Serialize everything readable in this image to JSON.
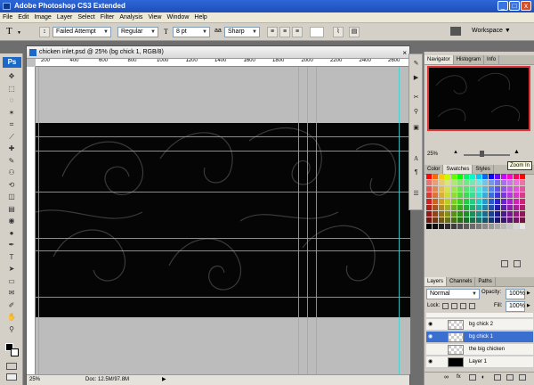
{
  "window": {
    "title": "Adobe Photoshop CS3 Extended",
    "min": "_",
    "max": "□",
    "close": "x"
  },
  "menu": [
    "File",
    "Edit",
    "Image",
    "Layer",
    "Select",
    "Filter",
    "Analysis",
    "View",
    "Window",
    "Help"
  ],
  "options": {
    "tool_glyph": "T",
    "font_family": "Failed Attempt",
    "font_style": "Regular",
    "font_size": "8 pt",
    "antialias": "Sharp",
    "workspace": "Workspace ▼"
  },
  "logo": "Ps",
  "document": {
    "title": "chicken inlet.psd @ 25% (bg chick 1, RGB/8)",
    "zoom": "25%",
    "doc_info": "Doc: 12.5M/97.8M",
    "ruler_labels": [
      "200",
      "400",
      "600",
      "800",
      "1000",
      "1200",
      "1400",
      "1600",
      "1800",
      "2000",
      "2200",
      "2400",
      "2600"
    ]
  },
  "navigator": {
    "tabs": [
      "Navigator",
      "Histogram",
      "Info"
    ],
    "zoom": "25%"
  },
  "color": {
    "tabs": [
      "Color",
      "Swatches",
      "Styles"
    ],
    "tooltip": "Zoom In"
  },
  "layers": {
    "tabs": [
      "Layers",
      "Channels",
      "Paths"
    ],
    "blend_mode": "Normal",
    "opacity_label": "Opacity:",
    "opacity": "100%",
    "lock_label": "Lock:",
    "fill_label": "Fill:",
    "fill": "100%",
    "items": [
      {
        "name": "bg chick 2",
        "selected": false,
        "visible": true
      },
      {
        "name": "bg chick 1",
        "selected": true,
        "visible": true
      },
      {
        "name": "the big chicken",
        "selected": false,
        "visible": false
      },
      {
        "name": "Layer 1",
        "selected": false,
        "visible": true
      }
    ]
  },
  "colors": {
    "guide": "#3bd4d4",
    "canvas": "#050505",
    "selection": "#3a6fd0"
  },
  "icons": [
    "move-icon",
    "marquee-icon",
    "lasso-icon",
    "magic-wand-icon",
    "crop-icon",
    "slice-icon",
    "healing-icon",
    "brush-icon",
    "stamp-icon",
    "history-brush-icon",
    "eraser-icon",
    "gradient-icon",
    "blur-icon",
    "dodge-icon",
    "pen-icon",
    "type-icon",
    "path-select-icon",
    "shape-icon",
    "notes-icon",
    "eyedropper-icon",
    "hand-icon",
    "zoom-icon"
  ]
}
